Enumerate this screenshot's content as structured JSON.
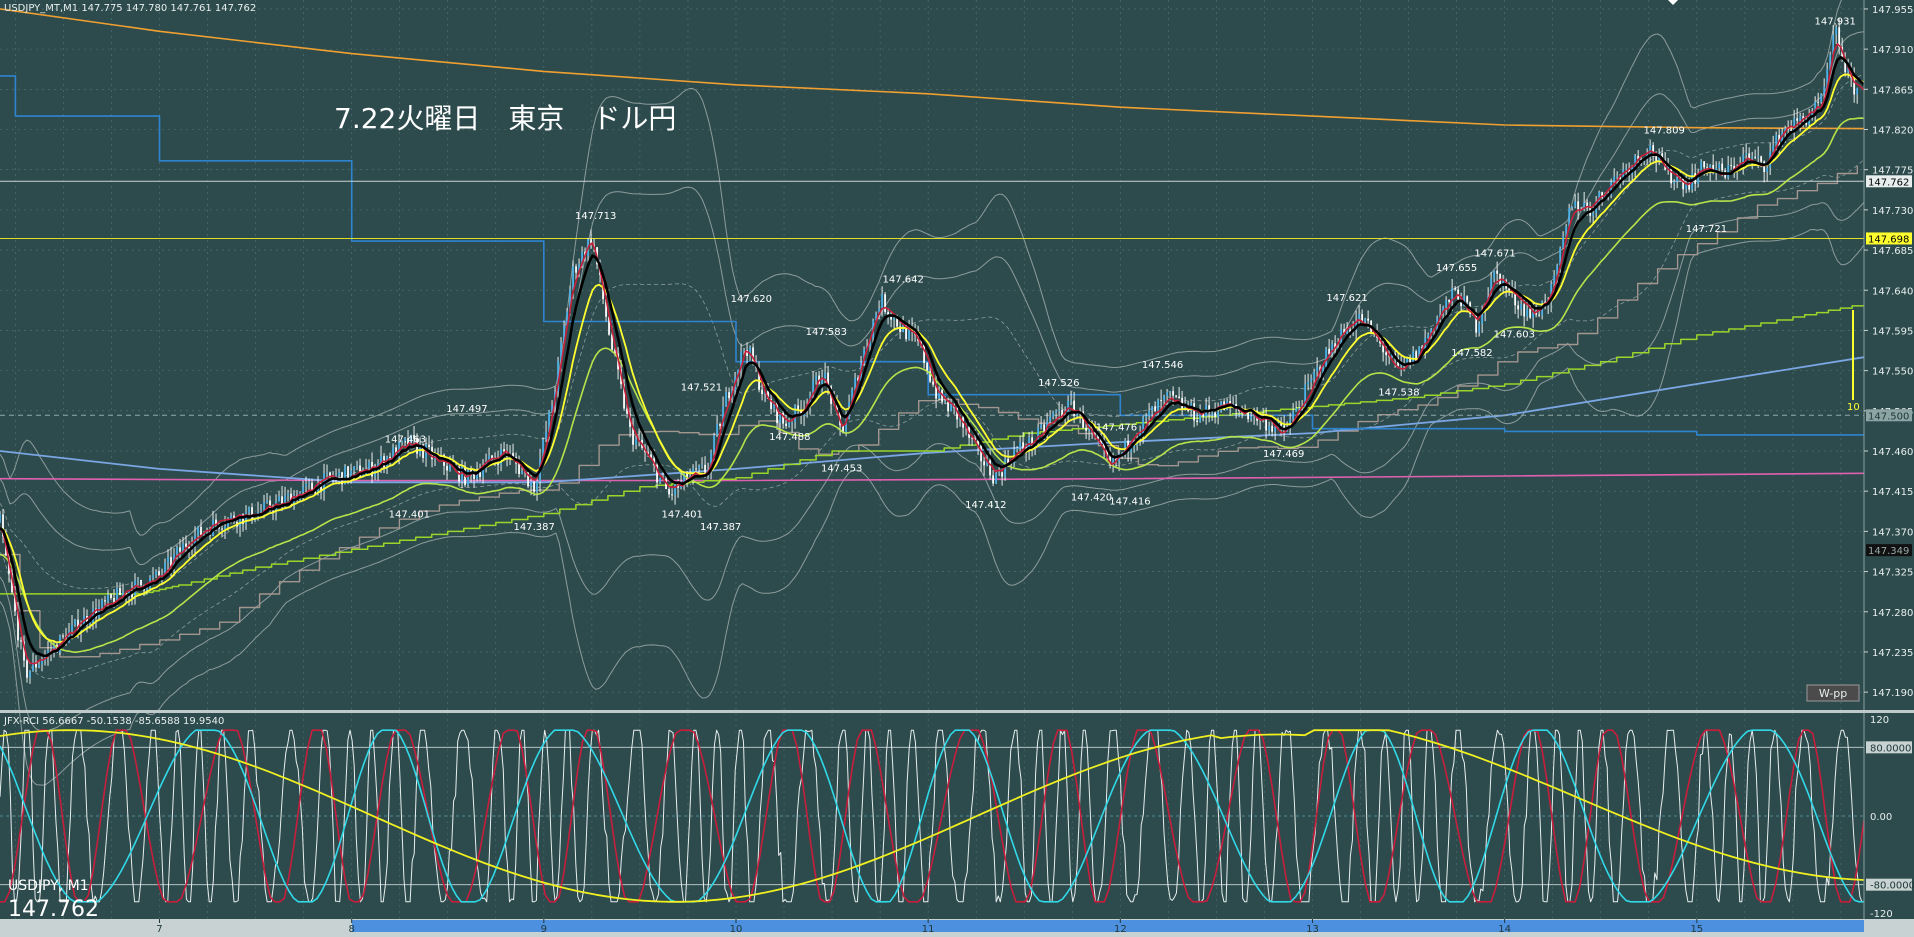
{
  "window": {
    "header_label": "USDJPY_MT,M1  147.775 147.780 147.761 147.762",
    "annotation_title": "7.22火曜日　東京　ドル円",
    "symbol_label": "USDJPY, M1",
    "last_price": "147.762",
    "wpp_button": "W-pp",
    "subwindow_header": "JFX-RCI 56.6667 -50.1538 -85.6588 19.9540",
    "scale_marker": "10"
  },
  "colors": {
    "background": "#2d4b4d",
    "grid": "#6a8688",
    "candle": "#4fb1e6",
    "ema_fast": "#c8203a",
    "ema_black": "#000000",
    "ma_yellow": "#ffff30",
    "ma_green": "#b7e34a",
    "kijun_lime": "#9ad52a",
    "stair_grey": "#a3958f",
    "bollinger": "#8d9b9b",
    "ma_orange": "#f0a030",
    "blue_steps": "#2f84d0",
    "light_blue": "#7aa6e3",
    "pink": "#e060b0",
    "rci_white": "#e8eeee",
    "rci_red": "#c81e3c",
    "rci_cyan": "#30d8e8",
    "rci_yellow": "#f0f020"
  },
  "chart_data": [
    {
      "type": "candlestick",
      "symbol": "USDJPY",
      "timeframe": "M1",
      "y_tick_labels": [
        "147.955",
        "147.910",
        "147.865",
        "147.820",
        "147.775",
        "147.730",
        "147.685",
        "147.640",
        "147.595",
        "147.550",
        "147.505",
        "147.460",
        "147.415",
        "147.370",
        "147.325",
        "147.280",
        "147.235",
        "147.190"
      ],
      "ylim": [
        147.17,
        147.965
      ],
      "x_tick_labels": [
        {
          "label": "7",
          "hour": 7
        },
        {
          "label": "8",
          "hour": 8
        },
        {
          "label": "9",
          "hour": 9
        },
        {
          "label": "10",
          "hour": 10
        },
        {
          "label": "11",
          "hour": 11
        },
        {
          "label": "12",
          "hour": 12
        },
        {
          "label": "13",
          "hour": 13
        },
        {
          "label": "14",
          "hour": 14
        },
        {
          "label": "15",
          "hour": 15
        }
      ],
      "xlim_hours": [
        6.17,
        15.87
      ],
      "price_path": [
        [
          6.17,
          147.38
        ],
        [
          6.3,
          147.21
        ],
        [
          6.45,
          147.24
        ],
        [
          6.6,
          147.27
        ],
        [
          6.8,
          147.3
        ],
        [
          7.0,
          147.32
        ],
        [
          7.15,
          147.36
        ],
        [
          7.3,
          147.38
        ],
        [
          7.5,
          147.39
        ],
        [
          7.7,
          147.41
        ],
        [
          7.9,
          147.43
        ],
        [
          8.1,
          147.44
        ],
        [
          8.3,
          147.47
        ],
        [
          8.45,
          147.45
        ],
        [
          8.6,
          147.43
        ],
        [
          8.8,
          147.46
        ],
        [
          8.95,
          147.42
        ],
        [
          9.05,
          147.52
        ],
        [
          9.15,
          147.66
        ],
        [
          9.25,
          147.7
        ],
        [
          9.35,
          147.58
        ],
        [
          9.45,
          147.48
        ],
        [
          9.55,
          147.45
        ],
        [
          9.65,
          147.41
        ],
        [
          9.75,
          147.43
        ],
        [
          9.85,
          147.44
        ],
        [
          9.95,
          147.52
        ],
        [
          10.05,
          147.58
        ],
        [
          10.15,
          147.52
        ],
        [
          10.25,
          147.49
        ],
        [
          10.35,
          147.51
        ],
        [
          10.45,
          147.55
        ],
        [
          10.55,
          147.48
        ],
        [
          10.65,
          147.56
        ],
        [
          10.75,
          147.63
        ],
        [
          10.85,
          147.6
        ],
        [
          10.95,
          147.58
        ],
        [
          11.05,
          147.52
        ],
        [
          11.15,
          147.5
        ],
        [
          11.25,
          147.46
        ],
        [
          11.35,
          147.43
        ],
        [
          11.45,
          147.46
        ],
        [
          11.55,
          147.47
        ],
        [
          11.65,
          147.5
        ],
        [
          11.75,
          147.51
        ],
        [
          11.85,
          147.48
        ],
        [
          11.95,
          147.44
        ],
        [
          12.05,
          147.47
        ],
        [
          12.15,
          147.5
        ],
        [
          12.25,
          147.52
        ],
        [
          12.4,
          147.5
        ],
        [
          12.55,
          147.51
        ],
        [
          12.7,
          147.5
        ],
        [
          12.85,
          147.48
        ],
        [
          12.95,
          147.52
        ],
        [
          13.05,
          147.56
        ],
        [
          13.15,
          147.59
        ],
        [
          13.25,
          147.61
        ],
        [
          13.35,
          147.58
        ],
        [
          13.45,
          147.55
        ],
        [
          13.55,
          147.57
        ],
        [
          13.65,
          147.61
        ],
        [
          13.75,
          147.64
        ],
        [
          13.85,
          147.6
        ],
        [
          13.95,
          147.66
        ],
        [
          14.05,
          147.63
        ],
        [
          14.15,
          147.61
        ],
        [
          14.25,
          147.64
        ],
        [
          14.35,
          147.74
        ],
        [
          14.45,
          147.73
        ],
        [
          14.55,
          147.76
        ],
        [
          14.65,
          147.78
        ],
        [
          14.75,
          147.8
        ],
        [
          14.85,
          147.77
        ],
        [
          14.95,
          147.76
        ],
        [
          15.05,
          147.78
        ],
        [
          15.15,
          147.77
        ],
        [
          15.25,
          147.79
        ],
        [
          15.35,
          147.78
        ],
        [
          15.45,
          147.82
        ],
        [
          15.55,
          147.83
        ],
        [
          15.65,
          147.85
        ],
        [
          15.72,
          147.93
        ],
        [
          15.8,
          147.87
        ],
        [
          15.87,
          147.86
        ]
      ],
      "annotations": [
        {
          "label": "147.713",
          "hour": 9.27,
          "price": 147.713,
          "pos": "above"
        },
        {
          "label": "147.463",
          "hour": 8.28,
          "price": 147.463,
          "pos": "above"
        },
        {
          "label": "147.497",
          "hour": 8.6,
          "price": 147.497,
          "pos": "above"
        },
        {
          "label": "147.401",
          "hour": 8.3,
          "price": 147.401,
          "pos": "below"
        },
        {
          "label": "147.387",
          "hour": 8.95,
          "price": 147.387,
          "pos": "below"
        },
        {
          "label": "147.620",
          "hour": 10.08,
          "price": 147.62,
          "pos": "above"
        },
        {
          "label": "147.521",
          "hour": 9.82,
          "price": 147.521,
          "pos": "above"
        },
        {
          "label": "147.583",
          "hour": 10.47,
          "price": 147.583,
          "pos": "above"
        },
        {
          "label": "147.642",
          "hour": 10.87,
          "price": 147.642,
          "pos": "above"
        },
        {
          "label": "147.488",
          "hour": 10.28,
          "price": 147.488,
          "pos": "below"
        },
        {
          "label": "147.453",
          "hour": 10.55,
          "price": 147.453,
          "pos": "below"
        },
        {
          "label": "147.401",
          "hour": 9.72,
          "price": 147.401,
          "pos": "below"
        },
        {
          "label": "147.387",
          "hour": 9.92,
          "price": 147.387,
          "pos": "below"
        },
        {
          "label": "147.526",
          "hour": 11.68,
          "price": 147.526,
          "pos": "above"
        },
        {
          "label": "147.546",
          "hour": 12.22,
          "price": 147.546,
          "pos": "above"
        },
        {
          "label": "147.476",
          "hour": 11.98,
          "price": 147.476,
          "pos": "above"
        },
        {
          "label": "147.412",
          "hour": 11.3,
          "price": 147.412,
          "pos": "below"
        },
        {
          "label": "147.420",
          "hour": 11.85,
          "price": 147.42,
          "pos": "below"
        },
        {
          "label": "147.416",
          "hour": 12.05,
          "price": 147.416,
          "pos": "below"
        },
        {
          "label": "147.469",
          "hour": 12.85,
          "price": 147.469,
          "pos": "below"
        },
        {
          "label": "147.621",
          "hour": 13.18,
          "price": 147.621,
          "pos": "above"
        },
        {
          "label": "147.538",
          "hour": 13.45,
          "price": 147.538,
          "pos": "below"
        },
        {
          "label": "147.655",
          "hour": 13.75,
          "price": 147.655,
          "pos": "above"
        },
        {
          "label": "147.671",
          "hour": 13.95,
          "price": 147.671,
          "pos": "above"
        },
        {
          "label": "147.582",
          "hour": 13.83,
          "price": 147.582,
          "pos": "below"
        },
        {
          "label": "147.603",
          "hour": 14.05,
          "price": 147.603,
          "pos": "below"
        },
        {
          "label": "147.809",
          "hour": 14.83,
          "price": 147.809,
          "pos": "above"
        },
        {
          "label": "147.721",
          "hour": 15.05,
          "price": 147.721,
          "pos": "below"
        },
        {
          "label": "147.931",
          "hour": 15.72,
          "price": 147.931,
          "pos": "above"
        }
      ],
      "horizontal_lines": [
        {
          "price": 147.762,
          "color": "#c9d4d4",
          "tag": "147.762",
          "tag_bg": "#e8eeee",
          "tag_fg": "#000000"
        },
        {
          "price": 147.698,
          "color": "#e0e020",
          "tag": "147.698",
          "tag_bg": "#ffff30",
          "tag_fg": "#000000"
        },
        {
          "price": 147.5,
          "color": "#90a8a8",
          "tag": "147.500",
          "tag_bg": "#8da4a4",
          "tag_fg": "#20383a",
          "dashed": true
        },
        {
          "price": 147.349,
          "color": "#000000",
          "tag": "147.349",
          "tag_bg": "#111111",
          "tag_fg": "#9aa8a8",
          "no_line": true
        }
      ],
      "indicator_lines": {
        "orange": [
          [
            6.17,
            147.955
          ],
          [
            7.0,
            147.93
          ],
          [
            8.0,
            147.905
          ],
          [
            9.0,
            147.885
          ],
          [
            10.0,
            147.87
          ],
          [
            11.0,
            147.86
          ],
          [
            12.0,
            147.845
          ],
          [
            13.0,
            147.835
          ],
          [
            14.0,
            147.825
          ],
          [
            15.0,
            147.822
          ],
          [
            15.87,
            147.821
          ]
        ],
        "pink": [
          [
            6.17,
            147.429
          ],
          [
            8.0,
            147.427
          ],
          [
            10.0,
            147.427
          ],
          [
            12.0,
            147.429
          ],
          [
            14.0,
            147.432
          ],
          [
            15.87,
            147.435
          ]
        ],
        "light_blue": [
          [
            6.17,
            147.46
          ],
          [
            7.0,
            147.44
          ],
          [
            8.0,
            147.425
          ],
          [
            9.0,
            147.425
          ],
          [
            10.0,
            147.44
          ],
          [
            11.0,
            147.458
          ],
          [
            12.0,
            147.47
          ],
          [
            13.0,
            147.48
          ],
          [
            14.0,
            147.5
          ],
          [
            15.0,
            147.535
          ],
          [
            15.87,
            147.565
          ]
        ],
        "blue_steps": [
          [
            6.17,
            147.88
          ],
          [
            6.25,
            147.88
          ],
          [
            6.25,
            147.835
          ],
          [
            7.0,
            147.835
          ],
          [
            7.0,
            147.785
          ],
          [
            8.0,
            147.785
          ],
          [
            8.0,
            147.695
          ],
          [
            9.0,
            147.695
          ],
          [
            9.0,
            147.605
          ],
          [
            10.0,
            147.605
          ],
          [
            10.0,
            147.56
          ],
          [
            11.0,
            147.56
          ],
          [
            11.0,
            147.523
          ],
          [
            12.0,
            147.523
          ],
          [
            12.0,
            147.5
          ],
          [
            13.0,
            147.5
          ],
          [
            13.0,
            147.485
          ],
          [
            14.0,
            147.485
          ],
          [
            14.0,
            147.482
          ],
          [
            15.0,
            147.482
          ],
          [
            15.0,
            147.478
          ],
          [
            15.87,
            147.478
          ]
        ],
        "lime_steps": [
          [
            6.17,
            147.3
          ],
          [
            6.9,
            147.3
          ],
          [
            7.1,
            147.31
          ],
          [
            7.5,
            147.33
          ],
          [
            8.0,
            147.35
          ],
          [
            8.5,
            147.37
          ],
          [
            9.0,
            147.39
          ],
          [
            9.5,
            147.42
          ],
          [
            10.0,
            147.43
          ],
          [
            10.5,
            147.46
          ],
          [
            11.0,
            147.46
          ],
          [
            11.5,
            147.48
          ],
          [
            12.0,
            147.49
          ],
          [
            12.5,
            147.5
          ],
          [
            13.0,
            147.51
          ],
          [
            13.5,
            147.52
          ],
          [
            14.0,
            147.535
          ],
          [
            14.5,
            147.56
          ],
          [
            15.0,
            147.59
          ],
          [
            15.5,
            147.61
          ],
          [
            15.87,
            147.625
          ]
        ]
      },
      "subchart": {
        "title": "JFX-RCI",
        "values": {
          "rci_short": 56.6667,
          "rci_mid": -50.1538,
          "rci_long": -85.6588,
          "rci_4": 19.954
        },
        "y_tick_labels": [
          "120",
          "80.0000",
          "0.00",
          "-80.0000",
          "-120"
        ],
        "ylim": [
          -120,
          120
        ],
        "levels": [
          80,
          0,
          -80
        ]
      }
    }
  ]
}
